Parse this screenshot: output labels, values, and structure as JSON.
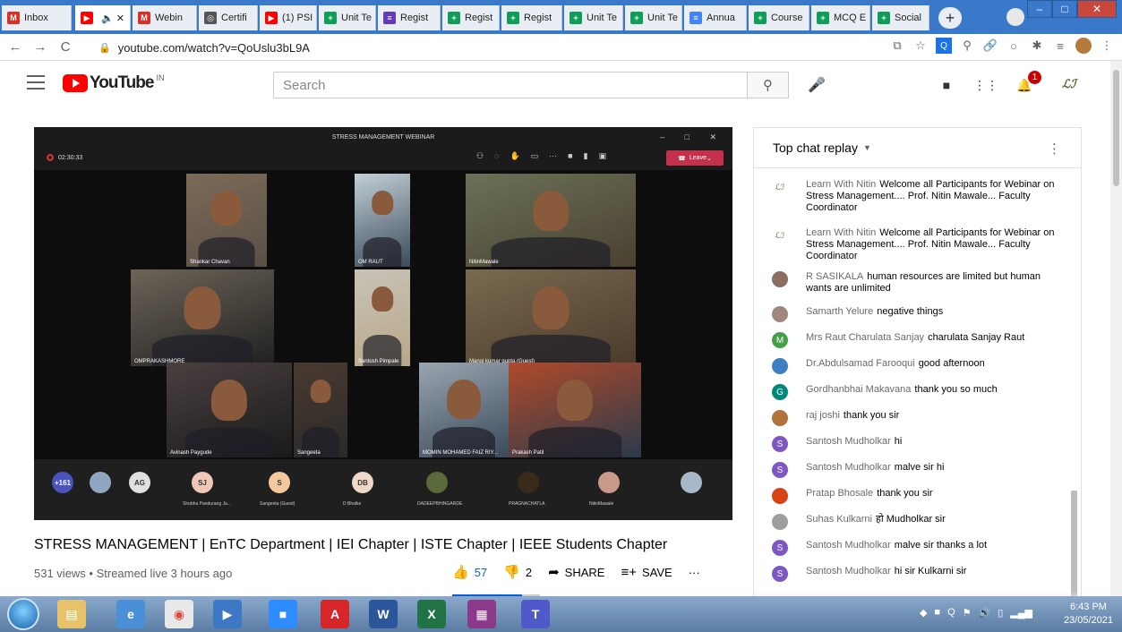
{
  "tabs": [
    {
      "label": "Inbox",
      "color": "#d93025",
      "glyph": "M"
    },
    {
      "label": "",
      "color": "#ff0000",
      "glyph": "▶"
    },
    {
      "label": "Webin",
      "color": "#d93025",
      "glyph": "M"
    },
    {
      "label": "Certifi",
      "color": "#555555",
      "glyph": "◎"
    },
    {
      "label": "(1) PSI",
      "color": "#ff0000",
      "glyph": "▶"
    },
    {
      "label": "Unit Te",
      "color": "#0f9d58",
      "glyph": "+"
    },
    {
      "label": "Regist",
      "color": "#673ab7",
      "glyph": "≡"
    },
    {
      "label": "Regist",
      "color": "#0f9d58",
      "glyph": "+"
    },
    {
      "label": "Regist",
      "color": "#0f9d58",
      "glyph": "+"
    },
    {
      "label": "Unit Te",
      "color": "#0f9d58",
      "glyph": "+"
    },
    {
      "label": "Unit Te",
      "color": "#0f9d58",
      "glyph": "+"
    },
    {
      "label": "Annua",
      "color": "#4285f4",
      "glyph": "≡"
    },
    {
      "label": "Course",
      "color": "#0f9d58",
      "glyph": "+"
    },
    {
      "label": "MCQ E",
      "color": "#0f9d58",
      "glyph": "+"
    },
    {
      "label": "Social",
      "color": "#0f9d58",
      "glyph": "+"
    }
  ],
  "address": {
    "url": "youtube.com/watch?v=QoUslu3bL9A"
  },
  "youtube": {
    "logo_text": "YouTube",
    "country": "IN",
    "search_placeholder": "Search",
    "notification_count": "1",
    "avatar_text": "ℒℐ"
  },
  "video": {
    "meeting_title": "STRESS MANAGEMENT WEBINAR",
    "elapsed": "02:30:33",
    "leave_label": "Leave",
    "participants": [
      {
        "name": "Shankar Chavan"
      },
      {
        "name": "OM RAUT"
      },
      {
        "name": "NitinMawale"
      },
      {
        "name": "OMPRAKASHMORE"
      },
      {
        "name": "Santosh Pimpale"
      },
      {
        "name": "Manoj kumar gupta (Guest)"
      },
      {
        "name": "Avinash Paygude"
      },
      {
        "name": "Sangeeta"
      },
      {
        "name": "MOMIN MOHAMED FAIZ RIY..."
      },
      {
        "name": "Prakash Patil"
      }
    ],
    "strip": [
      {
        "initials": "+161",
        "label": ""
      },
      {
        "initials": "",
        "label": ""
      },
      {
        "initials": "AG",
        "label": ""
      },
      {
        "initials": "SJ",
        "label": "Shobha Pandurang Ja..."
      },
      {
        "initials": "S",
        "label": "Sangeeta (Guest)"
      },
      {
        "initials": "DB",
        "label": "D Bhalke"
      },
      {
        "initials": "",
        "label": "DADEEPBHINGARDE"
      },
      {
        "initials": "",
        "label": "PRAGNACHATLA"
      },
      {
        "initials": "",
        "label": "NitinMawale"
      },
      {
        "initials": "",
        "label": ""
      }
    ]
  },
  "title": "STRESS MANAGEMENT | EnTC Department | IEI Chapter | ISTE Chapter | IEEE Students Chapter",
  "meta": "531 views • Streamed live 3 hours ago",
  "actions": {
    "likes": "57",
    "dislikes": "2",
    "share": "SHARE",
    "save": "SAVE"
  },
  "chat": {
    "header": "Top chat replay",
    "messages": [
      {
        "author": "Learn With Nitin",
        "text": "Welcome all Participants for Webinar on Stress Management.... Prof. Nitin Mawale... Faculty Coordinator",
        "avatar": "ℒℐ",
        "avatar_color": "#ffffff"
      },
      {
        "author": "Learn With Nitin",
        "text": "Welcome all Participants for Webinar on Stress Management.... Prof. Nitin Mawale... Faculty Coordinator",
        "avatar": "ℒℐ",
        "avatar_color": "#ffffff"
      },
      {
        "author": "R SASIKALA",
        "text": "human resources are limited but human wants are unlimited",
        "avatar": "",
        "avatar_color": "#8d6e63"
      },
      {
        "author": "Samarth Yelure",
        "text": "negative things",
        "avatar": "",
        "avatar_color": "#a1887f"
      },
      {
        "author": "Mrs Raut Charulata Sanjay",
        "text": "charulata Sanjay Raut",
        "avatar": "M",
        "avatar_color": "#43a047"
      },
      {
        "author": "Dr.Abdulsamad Farooqui",
        "text": "good afternoon",
        "avatar": "",
        "avatar_color": "#3f7fbf"
      },
      {
        "author": "Gordhanbhai Makavana",
        "text": "thank you so much",
        "avatar": "G",
        "avatar_color": "#00897b"
      },
      {
        "author": "raj joshi",
        "text": "thank you sir",
        "avatar": "",
        "avatar_color": "#b0733a"
      },
      {
        "author": "Santosh Mudholkar",
        "text": "hi",
        "avatar": "S",
        "avatar_color": "#7e57c2"
      },
      {
        "author": "Santosh Mudholkar",
        "text": "malve sir hi",
        "avatar": "S",
        "avatar_color": "#7e57c2"
      },
      {
        "author": "Pratap Bhosale",
        "text": "thank you sir",
        "avatar": "",
        "avatar_color": "#d84315"
      },
      {
        "author": "Suhas Kulkarni",
        "text": "हो Mudholkar sir",
        "avatar": "",
        "avatar_color": "#9e9e9e"
      },
      {
        "author": "Santosh Mudholkar",
        "text": "malve sir thanks a lot",
        "avatar": "S",
        "avatar_color": "#7e57c2"
      },
      {
        "author": "Santosh Mudholkar",
        "text": "hi sir Kulkarni sir",
        "avatar": "S",
        "avatar_color": "#7e57c2"
      }
    ]
  },
  "taskbar": {
    "time": "6:43 PM",
    "date": "23/05/2021"
  }
}
